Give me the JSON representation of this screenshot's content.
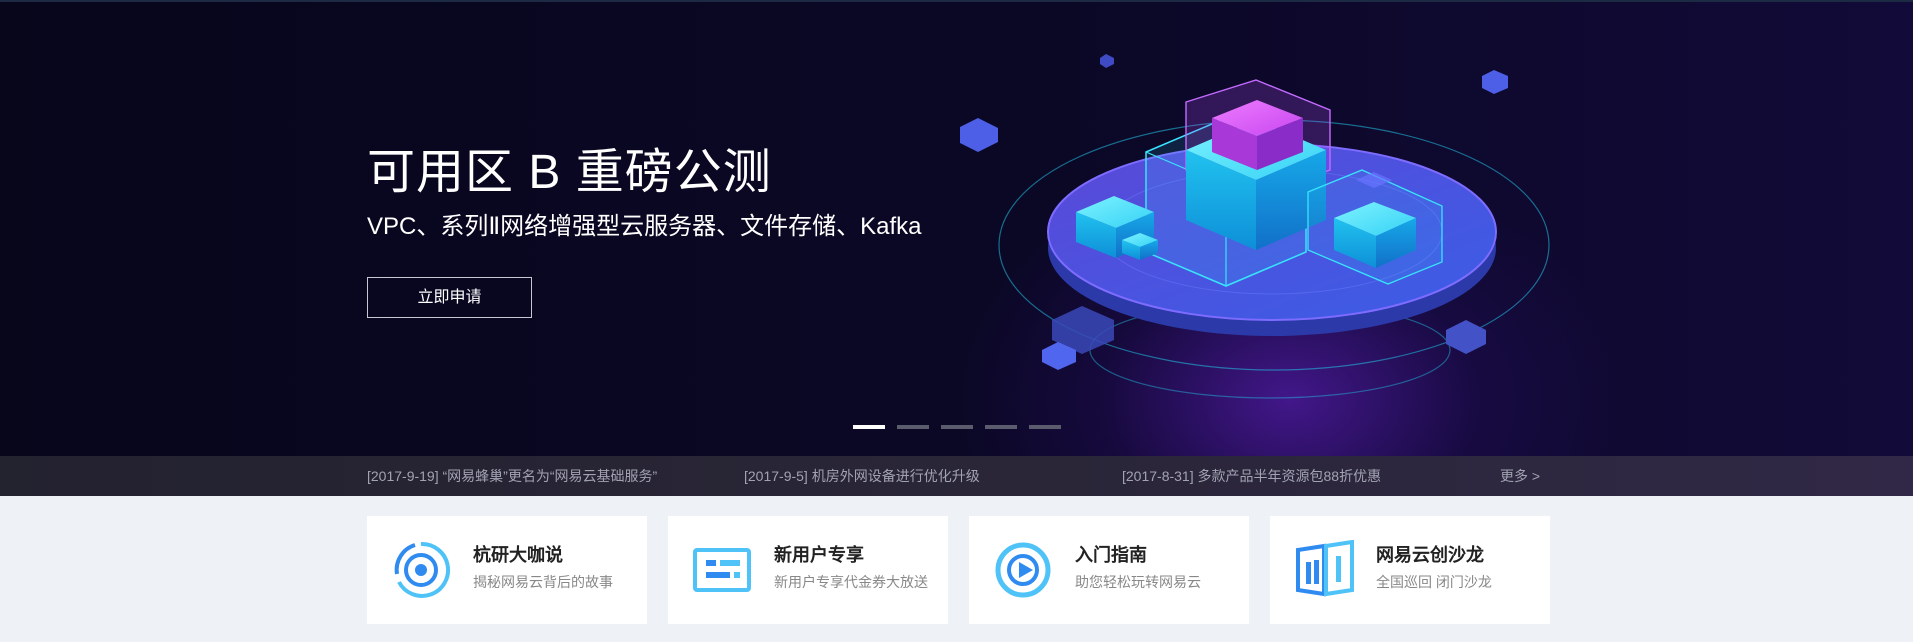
{
  "hero": {
    "title": "可用区 B 重磅公测",
    "subtitle": "VPC、系列Ⅱ网络增强型云服务器、文件存储、Kafka",
    "cta_label": "立即申请"
  },
  "carousel": {
    "slide_count": 5,
    "active_index": 0
  },
  "news": {
    "items": [
      "[2017-9-19] “网易蜂巢”更名为“网易云基础服务”",
      "[2017-9-5] 机房外网设备进行优化升级",
      "[2017-8-31] 多款产品半年资源包88折优惠"
    ],
    "more_label": "更多 >"
  },
  "cards": [
    {
      "title": "杭研大咖说",
      "desc": "揭秘网易云背后的故事",
      "icon": "target-icon"
    },
    {
      "title": "新用户专享",
      "desc": "新用户专享代金券大放送",
      "icon": "coupon-icon"
    },
    {
      "title": "入门指南",
      "desc": "助您轻松玩转网易云",
      "icon": "compass-icon"
    },
    {
      "title": "网易云创沙龙",
      "desc": "全国巡回 闭门沙龙",
      "icon": "book-icon"
    }
  ],
  "colors": {
    "icon_blue": "#2f8bf0",
    "icon_light_blue": "#4fc3f7",
    "banner_bg": "#0b0826"
  }
}
